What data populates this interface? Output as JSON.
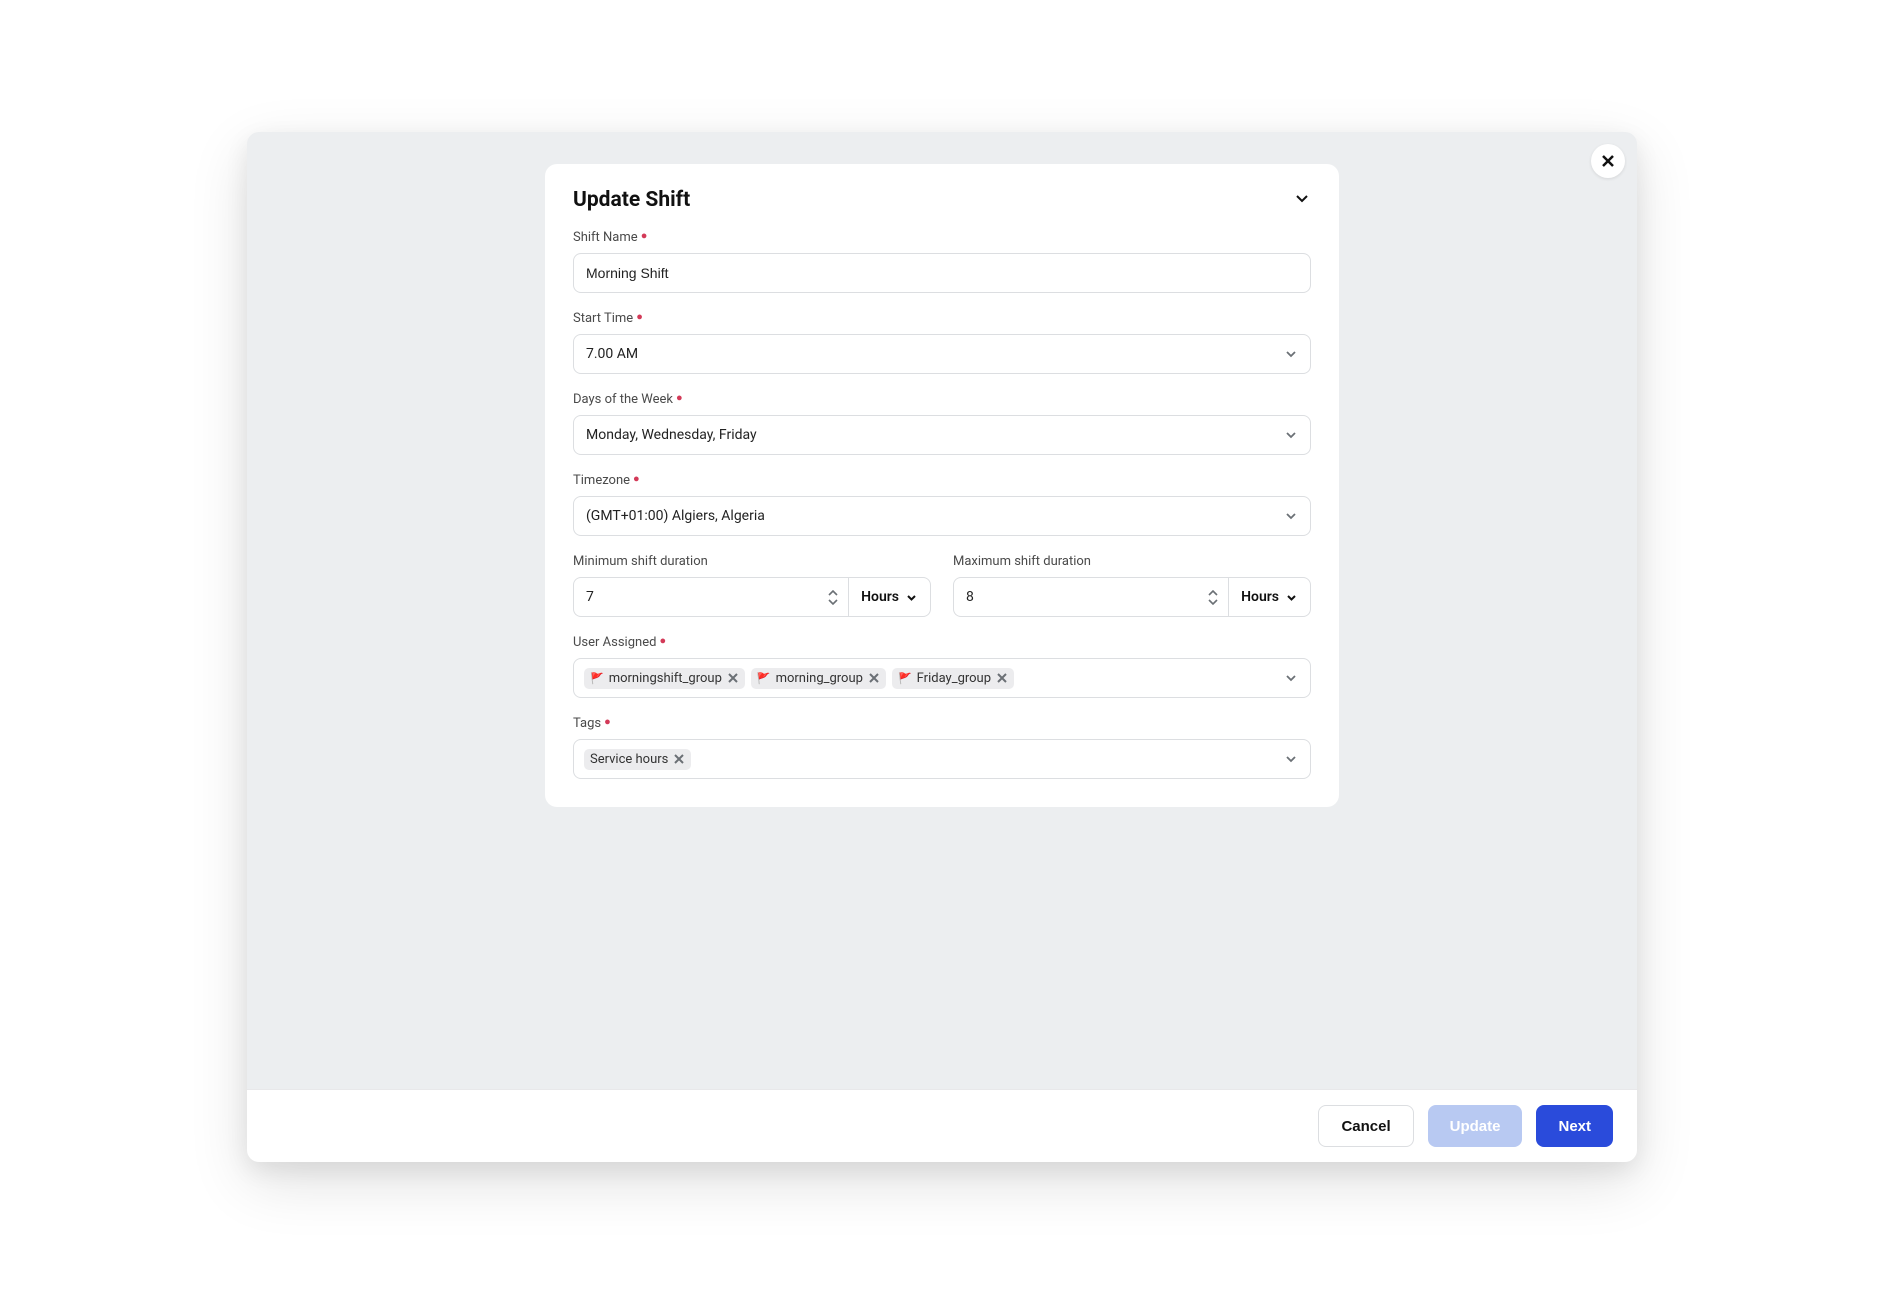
{
  "modal": {
    "title": "Update Shift"
  },
  "fields": {
    "shift_name": {
      "label": "Shift Name",
      "value": "Morning Shift"
    },
    "start_time": {
      "label": "Start Time",
      "value": "7.00 AM"
    },
    "days": {
      "label": "Days of the Week",
      "value": "Monday, Wednesday, Friday"
    },
    "timezone": {
      "label": "Timezone",
      "value": "(GMT+01:00) Algiers, Algeria"
    },
    "min_duration": {
      "label": "Minimum shift duration",
      "value": "7",
      "unit": "Hours"
    },
    "max_duration": {
      "label": "Maximum shift duration",
      "value": "8",
      "unit": "Hours"
    },
    "user_assigned": {
      "label": "User Assigned",
      "chips": [
        {
          "name": "morningshift_group"
        },
        {
          "name": "morning_group"
        },
        {
          "name": "Friday_group"
        }
      ]
    },
    "tags": {
      "label": "Tags",
      "chips": [
        {
          "name": "Service hours"
        }
      ]
    }
  },
  "footer": {
    "cancel": "Cancel",
    "update": "Update",
    "next": "Next"
  }
}
